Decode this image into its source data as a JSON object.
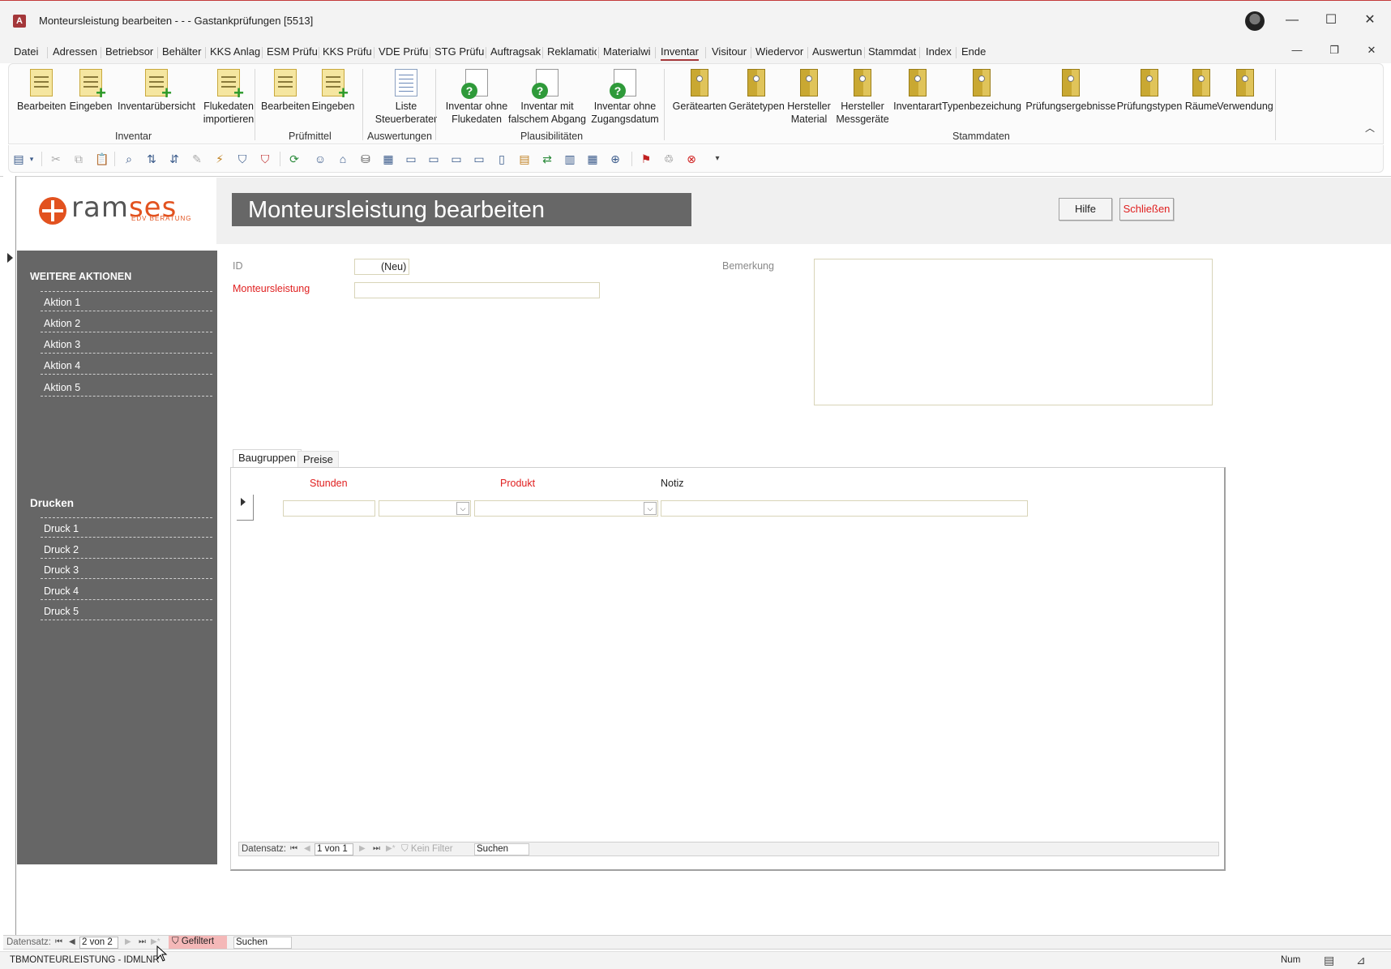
{
  "window": {
    "title": "Monteursleistung bearbeiten - -  -  Gastankprüfungen [5513]",
    "app_icon_letter": "A",
    "minimize": "—",
    "maximize": "☐",
    "close": "✕",
    "doc_minimize": "—",
    "doc_restore": "❐",
    "doc_close": "✕"
  },
  "ribbon_tabs": [
    "Datei",
    "Adressen",
    "Betriebsor",
    "Behälter",
    "KKS Anlag",
    "ESM Prüfu",
    "KKS Prüfur",
    "VDE Prüfui",
    "STG Prüfur",
    "Auftragsak",
    "Reklamatic",
    "Materialwi",
    "Inventar",
    "Visitour",
    "Wiedervor",
    "Auswertun",
    "Stammdat",
    "Index",
    "Ende"
  ],
  "active_tab": "Inventar",
  "ribbon": {
    "groups": {
      "inventar": "Inventar",
      "pruefmittel": "Prüfmittel",
      "auswertungen": "Auswertungen",
      "plausibilitaeten": "Plausibilitäten",
      "stammdaten": "Stammdaten"
    },
    "inventar_buttons": {
      "bearbeiten": "Bearbeiten",
      "eingeben": "Eingeben",
      "uebersicht": "Inventarübersicht",
      "fluke_1": "Flukedaten",
      "fluke_2": "importieren"
    },
    "pruefmittel_buttons": {
      "bearbeiten": "Bearbeiten",
      "eingeben": "Eingeben"
    },
    "auswertungen_buttons": {
      "liste_1": "Liste",
      "liste_2": "Steuerberater"
    },
    "plausi_buttons": {
      "b1_1": "Inventar ohne",
      "b1_2": "Flukedaten",
      "b2_1": "Inventar mit",
      "b2_2": "falschem Abgang",
      "b3_1": "Inventar ohne",
      "b3_2": "Zugangsdatum"
    },
    "stamm_buttons": {
      "geraetearten": "Gerätearten",
      "geraetetypen": "Gerätetypen",
      "hersteller_mat_1": "Hersteller",
      "hersteller_mat_2": "Material",
      "hersteller_mess_1": "Hersteller",
      "hersteller_mess_2": "Messgeräte",
      "inventarart": "Inventarart",
      "typenbezeichnung": "Typenbezeichung",
      "pruefungsergebnisse": "Prüfungsergebnisse",
      "pruefungstypen": "Prüfungstypen",
      "raeume": "Räume",
      "verwendung": "Verwendung"
    },
    "collapse_icon": "︿"
  },
  "logo": {
    "part_a": "ram",
    "part_b": "ses",
    "sub": "EDV BERATUNG"
  },
  "form": {
    "title": "Monteursleistung bearbeiten",
    "help_button": "Hilfe",
    "close_button": "Schließen",
    "id_label": "ID",
    "id_value": "(Neu)",
    "monteursleistung_label": "Monteursleistung",
    "monteursleistung_value": "",
    "bemerkung_label": "Bemerkung",
    "bemerkung_value": ""
  },
  "sidebar": {
    "weitere_heading": "WEITERE AKTIONEN",
    "aktionen": [
      "Aktion 1",
      "Aktion 2",
      "Aktion 3",
      "Aktion 4",
      "Aktion 5"
    ],
    "drucken_heading": "Drucken",
    "drucke": [
      "Druck 1",
      "Druck 2",
      "Druck 3",
      "Druck 4",
      "Druck 5"
    ]
  },
  "subform": {
    "tabs": [
      "Baugruppen",
      "Preise"
    ],
    "active_tab": "Baugruppen",
    "columns": [
      "Stunden",
      "Produkt",
      "Notiz"
    ],
    "nav": {
      "label": "Datensatz:",
      "record": "1 von 1",
      "filter": "Kein Filter",
      "search": "Suchen"
    }
  },
  "main_nav": {
    "label": "Datensatz:",
    "record": "2 von 2",
    "filter": "Gefiltert",
    "search": "Suchen"
  },
  "status": {
    "left": "TBMONTEURLEISTUNG - IDMLNR",
    "num": "Num"
  }
}
